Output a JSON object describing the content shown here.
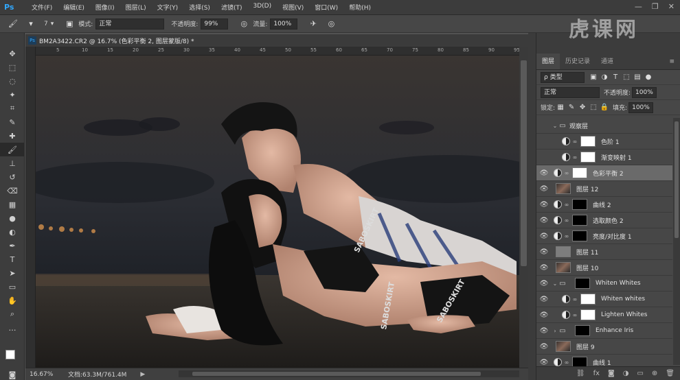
{
  "app": {
    "logo": "Ps"
  },
  "menu": [
    "文件(F)",
    "编辑(E)",
    "图像(I)",
    "图层(L)",
    "文字(Y)",
    "选择(S)",
    "滤镜(T)",
    "3D(D)",
    "视图(V)",
    "窗口(W)",
    "帮助(H)"
  ],
  "window_controls": {
    "minimize": "—",
    "restore": "❐",
    "close": "✕"
  },
  "watermark": "虎课网",
  "options": {
    "mode_label": "模式:",
    "mode_value": "正常",
    "opacity_label": "不透明度:",
    "opacity_value": "99%",
    "flow_label": "流量:",
    "flow_value": "100%",
    "brush_size": "7"
  },
  "document": {
    "tab_title": "BM2A3422.CR2 @ 16.7% (色彩平衡 2, 图层蒙版/8) *",
    "ruler_ticks": [
      "5",
      "10",
      "15",
      "20",
      "25",
      "30",
      "35",
      "40",
      "45",
      "50",
      "55",
      "60",
      "65",
      "70",
      "75",
      "80",
      "85",
      "90",
      "95"
    ],
    "status_zoom": "16.67%",
    "status_doc": "文档:63.3M/761.4M",
    "status_arrow": "▶",
    "photo_text": [
      "SABOSKIRT",
      "SABOSKIRT",
      "SABOSKIRT"
    ]
  },
  "layers_panel": {
    "tabs": [
      "图层",
      "历史记录",
      "通道"
    ],
    "active_tab": 0,
    "menu_icon": "≡",
    "filter_label": "ρ 类型",
    "blend_mode": "正常",
    "opacity_label": "不透明度:",
    "opacity_value": "100%",
    "lock_label": "锁定:",
    "fill_label": "填充:",
    "fill_value": "100%",
    "layers": [
      {
        "name": "观察层",
        "kind": "group",
        "visible": false,
        "indent": 0,
        "thumb": "none",
        "expanded": true
      },
      {
        "name": "色阶 1",
        "kind": "adjustment",
        "visible": false,
        "indent": 1,
        "thumb": "white"
      },
      {
        "name": "渐变映射 1",
        "kind": "adjustment",
        "visible": false,
        "indent": 1,
        "thumb": "white"
      },
      {
        "name": "色彩平衡 2",
        "kind": "adjustment",
        "visible": true,
        "indent": 0,
        "thumb": "white",
        "selected": true
      },
      {
        "name": "图层 12",
        "kind": "pixel",
        "visible": true,
        "indent": 0,
        "thumb": "photo"
      },
      {
        "name": "曲线 2",
        "kind": "adjustment",
        "visible": true,
        "indent": 0,
        "thumb": "black"
      },
      {
        "name": "选取颜色 2",
        "kind": "adjustment",
        "visible": true,
        "indent": 0,
        "thumb": "black"
      },
      {
        "name": "亮度/对比度 1",
        "kind": "adjustment",
        "visible": true,
        "indent": 0,
        "thumb": "black"
      },
      {
        "name": "图层 11",
        "kind": "pixel",
        "visible": true,
        "indent": 0,
        "thumb": "gray"
      },
      {
        "name": "图层 10",
        "kind": "pixel",
        "visible": true,
        "indent": 0,
        "thumb": "photo"
      },
      {
        "name": "Whiten Whites",
        "kind": "group",
        "visible": true,
        "indent": 0,
        "thumb": "black",
        "expanded": true
      },
      {
        "name": "Whiten whites",
        "kind": "adjustment",
        "visible": true,
        "indent": 1,
        "thumb": "white"
      },
      {
        "name": "Lighten Whites",
        "kind": "adjustment",
        "visible": true,
        "indent": 1,
        "thumb": "white"
      },
      {
        "name": "Enhance Iris",
        "kind": "group",
        "visible": true,
        "indent": 0,
        "thumb": "black",
        "expanded": false
      },
      {
        "name": "图层 9",
        "kind": "pixel",
        "visible": true,
        "indent": 0,
        "thumb": "photo"
      },
      {
        "name": "曲线 1",
        "kind": "adjustment",
        "visible": true,
        "indent": 0,
        "thumb": "black"
      }
    ]
  }
}
